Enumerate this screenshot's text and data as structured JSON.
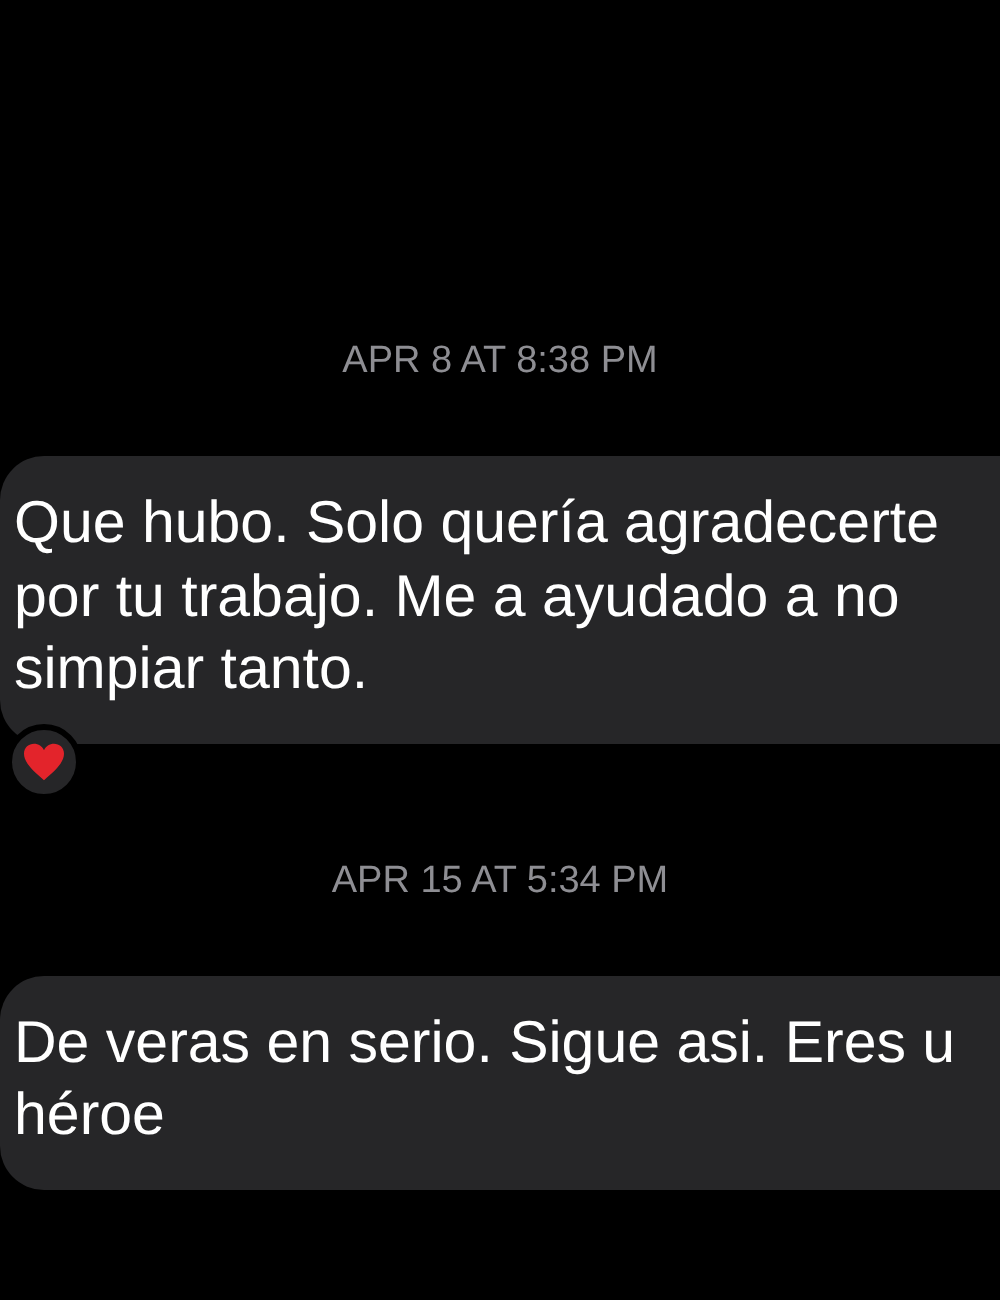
{
  "thread": [
    {
      "timestamp": "APR 8 AT 8:38 PM",
      "message": {
        "text": "Que hubo. Solo quería agradecerte\npor tu trabajo. Me a ayudado a no\nsimpiar tanto.",
        "heart_reaction": true
      }
    },
    {
      "timestamp": "APR 15 AT 5:34 PM",
      "message": {
        "text": "De veras en serio. Sigue asi. Eres u\nhéroe",
        "heart_reaction": false
      }
    }
  ]
}
